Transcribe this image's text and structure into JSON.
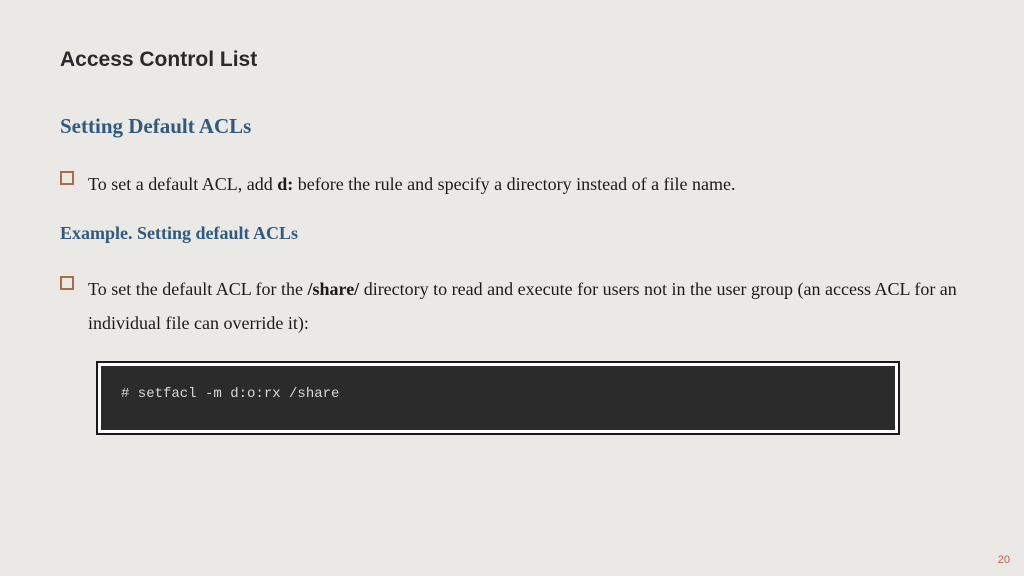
{
  "title": "Access Control List",
  "heading": "Setting Default ACLs",
  "bullet1": {
    "pre": "To set a default ACL, add ",
    "bold": "d:",
    "post": " before the rule and specify a directory instead of a file name."
  },
  "subheading": "Example. Setting default ACLs",
  "bullet2": {
    "pre": "To set the default ACL for the  ",
    "bold": "/share/",
    "post": " directory to read and execute for users not in the user group (an access ACL for an individual file can override it):"
  },
  "code": "# setfacl -m d:o:rx /share",
  "page": "20"
}
